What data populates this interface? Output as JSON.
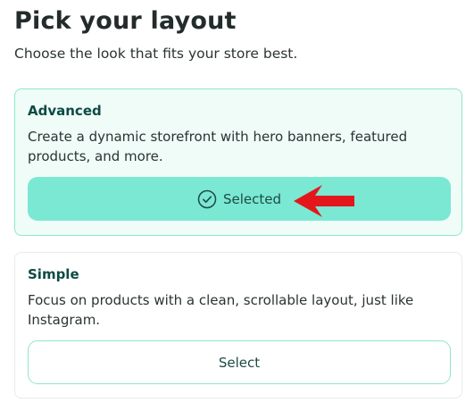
{
  "header": {
    "title": "Pick your layout",
    "subtitle": "Choose the look that fits your store best."
  },
  "cards": [
    {
      "title": "Advanced",
      "description": "Create a dynamic storefront with hero banners, featured products, and more.",
      "button_label": "Selected",
      "button_icon": "check-circle-icon",
      "state": "selected"
    },
    {
      "title": "Simple",
      "description": "Focus on products with a clean, scrollable layout, just like Instagram.",
      "button_label": "Select",
      "state": "unselected"
    }
  ],
  "annotation": {
    "arrow_color": "#e3171b",
    "arrow_icon": "red-arrow-left-icon"
  },
  "colors": {
    "accent": "#7ae8d2",
    "accent_border": "#8fe6cf",
    "selected_card_bg": "#effcf8",
    "title_green": "#0e4a45"
  }
}
